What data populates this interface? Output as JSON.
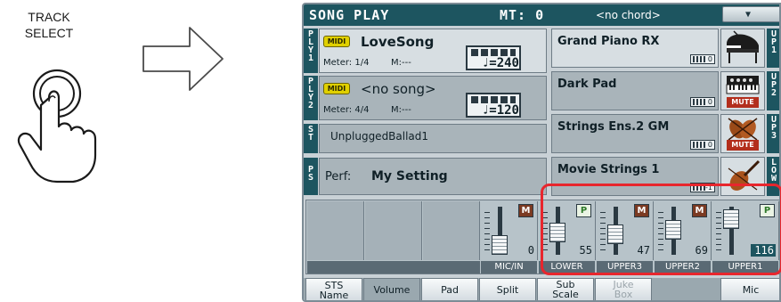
{
  "instruction": {
    "button_label_line1": "TRACK",
    "button_label_line2": "SELECT"
  },
  "header": {
    "title": "SONG PLAY",
    "master_transpose": "MT: 0",
    "chord": "<no chord>",
    "menu_icon": "chevron-down-icon"
  },
  "players": [
    {
      "tab": "PLY1",
      "badge": "MIDI",
      "song": "LoveSong",
      "meter": "Meter: 1/4",
      "measure": "M:---",
      "tempo": "♩=240"
    },
    {
      "tab": "PLY2",
      "badge": "MIDI",
      "song": "<no song>",
      "meter": "Meter: 4/4",
      "measure": "M:---",
      "tempo": "♩=120"
    }
  ],
  "style_panel": {
    "tab": "ST",
    "text": "UnpluggedBallad1"
  },
  "perf_panel": {
    "tab": "PS",
    "label": "Perf:",
    "name": "My Setting"
  },
  "sounds": [
    {
      "name": "Grand Piano RX",
      "octave": "0",
      "icon": "grand-piano-icon",
      "mute": "",
      "tab": "UP1"
    },
    {
      "name": "Dark Pad",
      "octave": "0",
      "icon": "synth-keyboard-icon",
      "mute": "MUTE",
      "tab": "UP2"
    },
    {
      "name": "Strings Ens.2 GM",
      "octave": "0",
      "icon": "strings-section-icon",
      "mute": "MUTE",
      "tab": "UP3"
    },
    {
      "name": "Movie Strings 1",
      "octave": "-1",
      "icon": "violin-icon",
      "mute": "",
      "tab": "LOW"
    }
  ],
  "mixer": {
    "channels": [
      {
        "label": "MIC/IN",
        "flag": "M",
        "level": "0",
        "selected": false
      },
      {
        "label": "LOWER",
        "flag": "P",
        "level": "55",
        "selected": false
      },
      {
        "label": "UPPER3",
        "flag": "M",
        "level": "47",
        "selected": false
      },
      {
        "label": "UPPER2",
        "flag": "M",
        "level": "69",
        "selected": false
      },
      {
        "label": "UPPER1",
        "flag": "P",
        "level": "116",
        "selected": true
      }
    ]
  },
  "tabs": [
    {
      "line1": "STS",
      "line2": "Name",
      "state": "normal"
    },
    {
      "line1": "Volume",
      "line2": "",
      "state": "active"
    },
    {
      "line1": "Pad",
      "line2": "",
      "state": "normal"
    },
    {
      "line1": "Split",
      "line2": "",
      "state": "normal"
    },
    {
      "line1": "Sub",
      "line2": "Scale",
      "state": "normal"
    },
    {
      "line1": "Juke",
      "line2": "Box",
      "state": "disabled"
    },
    {
      "line1": "Mic",
      "line2": "",
      "state": "normal"
    }
  ],
  "colors": {
    "header_bg": "#1d5560",
    "panel_bg": "#d7dee2",
    "mute_red": "#b32e1c",
    "highlight_red": "#e8262d",
    "midi_yellow": "#e0d000"
  }
}
